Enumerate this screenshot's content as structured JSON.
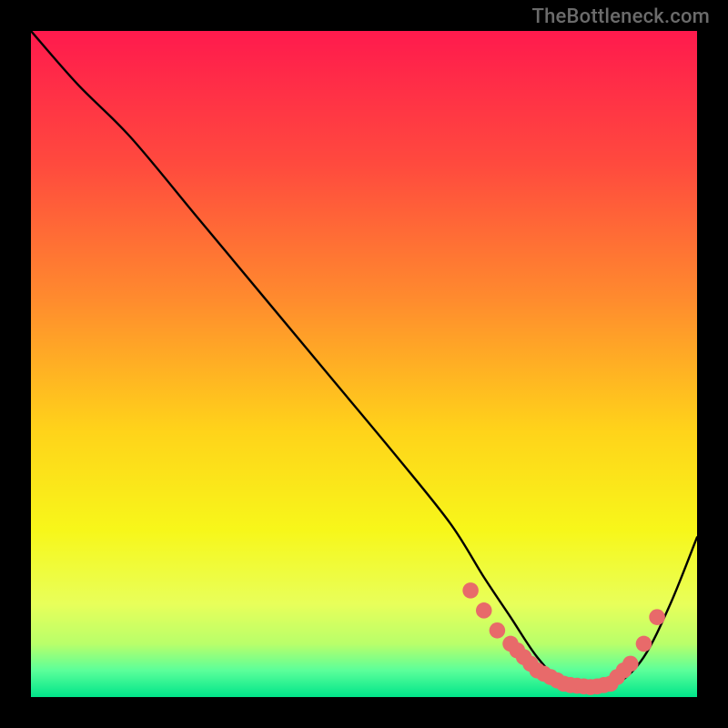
{
  "watermark": "TheBottleneck.com",
  "chart_data": {
    "type": "line",
    "title": "",
    "xlabel": "",
    "ylabel": "",
    "xlim": [
      0,
      100
    ],
    "ylim": [
      0,
      100
    ],
    "grid": false,
    "legend": false,
    "background_gradient": {
      "stops": [
        {
          "offset": 0.0,
          "color": "#ff1a4d"
        },
        {
          "offset": 0.2,
          "color": "#ff4a3e"
        },
        {
          "offset": 0.4,
          "color": "#ff8a2e"
        },
        {
          "offset": 0.6,
          "color": "#ffd31a"
        },
        {
          "offset": 0.75,
          "color": "#f7f71a"
        },
        {
          "offset": 0.86,
          "color": "#e8ff5a"
        },
        {
          "offset": 0.92,
          "color": "#b9ff6a"
        },
        {
          "offset": 0.96,
          "color": "#5bff9a"
        },
        {
          "offset": 1.0,
          "color": "#00e58a"
        }
      ]
    },
    "series": [
      {
        "name": "curve",
        "color": "#000000",
        "x": [
          0,
          7,
          15,
          25,
          35,
          45,
          55,
          63,
          68,
          72,
          76,
          80,
          84,
          88,
          92,
          96,
          100
        ],
        "y": [
          100,
          92,
          84,
          72,
          60,
          48,
          36,
          26,
          18,
          12,
          6,
          2,
          1,
          2,
          6,
          14,
          24
        ]
      }
    ],
    "markers": {
      "name": "dots",
      "color": "#e86a6a",
      "radius": 1.2,
      "x": [
        66,
        68,
        70,
        72,
        73,
        74,
        75,
        76,
        77,
        78,
        79,
        80,
        81,
        82,
        83,
        84,
        85,
        86,
        87,
        88,
        89,
        90,
        92,
        94
      ],
      "y": [
        16,
        13,
        10,
        8,
        7,
        6,
        5,
        4,
        3.5,
        3,
        2.5,
        2,
        1.8,
        1.7,
        1.6,
        1.5,
        1.6,
        1.8,
        2,
        3,
        4,
        5,
        8,
        12
      ]
    }
  }
}
